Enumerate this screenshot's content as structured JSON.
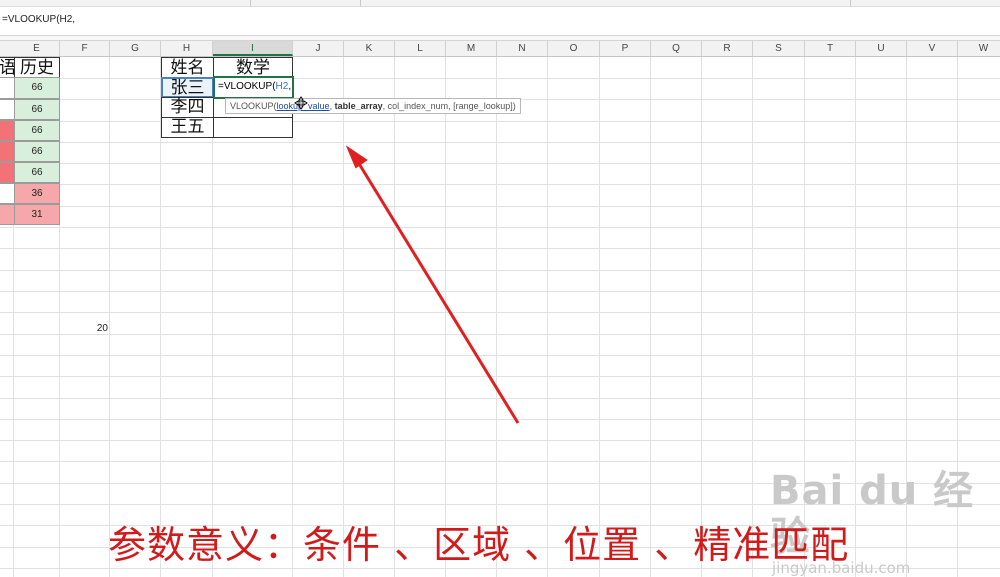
{
  "formula_bar": {
    "text": "=VLOOKUP(H2,"
  },
  "columns": [
    "E",
    "F",
    "G",
    "H",
    "I",
    "J",
    "K",
    "L",
    "M",
    "N",
    "O",
    "P",
    "Q",
    "R",
    "S",
    "T",
    "U",
    "V",
    "W"
  ],
  "active_column": "I",
  "left_table": {
    "partial_header": "语",
    "header": "历史",
    "values": [
      "66",
      "66",
      "66",
      "66",
      "66",
      "36",
      "31"
    ],
    "cell_fill": [
      "green",
      "green",
      "green",
      "green",
      "green",
      "red",
      "red"
    ],
    "left_strip_fill": [
      "white",
      "white",
      "red",
      "red",
      "red",
      "white",
      "red"
    ],
    "colors": {
      "green": "#d8efdb",
      "red": "#f6a7a9",
      "strong_red": "#f27276"
    }
  },
  "stray_value": "20",
  "lookup_table": {
    "header_name": "姓名",
    "header_math": "数学",
    "names": [
      "张三",
      "李四",
      "王五"
    ]
  },
  "active_cell": {
    "formula_black": "=VLOOKUP(",
    "formula_blue": "H2",
    "formula_tail": ","
  },
  "tooltip": {
    "func": "VLOOKUP(",
    "arg1": "lookup_value",
    "sep1": ", ",
    "arg2": "table_array",
    "rest": ", col_index_num, [range_lookup])"
  },
  "caption": "参数意义：条件 、区域 、位置 、精准匹配",
  "watermark": {
    "main": "Bai du 经验",
    "sub": "jingyan.baidu.com"
  },
  "accent_colors": {
    "excel_green": "#217346",
    "arrow_red": "#e02020",
    "caption_red": "#d31a1a"
  }
}
